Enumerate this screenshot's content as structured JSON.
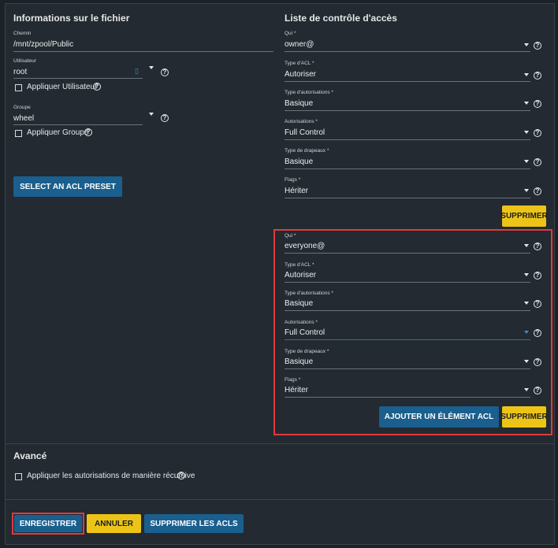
{
  "file_info": {
    "title": "Informations sur le fichier",
    "path": {
      "label": "Chemin",
      "value": "/mnt/zpool/Public"
    },
    "user": {
      "label": "Utilisateur",
      "value": "root",
      "apply_label": "Appliquer Utilisateur"
    },
    "group": {
      "label": "Groupe",
      "value": "wheel",
      "apply_label": "Appliquer Groupe"
    },
    "preset_button": "SELECT AN ACL PRESET"
  },
  "acl": {
    "title": "Liste de contrôle d'accès",
    "entries": [
      {
        "who": {
          "label": "Qui *",
          "value": "owner@"
        },
        "acl_type": {
          "label": "Type d'ACL *",
          "value": "Autoriser"
        },
        "perm_type": {
          "label": "Type d'autorisations *",
          "value": "Basique"
        },
        "perms": {
          "label": "Autorisations *",
          "value": "Full Control"
        },
        "flag_type": {
          "label": "Type de drapeaux *",
          "value": "Basique"
        },
        "flags": {
          "label": "Flags *",
          "value": "Hériter"
        },
        "delete_button": "SUPPRIMER"
      },
      {
        "who": {
          "label": "Qui *",
          "value": "everyone@"
        },
        "acl_type": {
          "label": "Type d'ACL *",
          "value": "Autoriser"
        },
        "perm_type": {
          "label": "Type d'autorisations *",
          "value": "Basique"
        },
        "perms": {
          "label": "Autorisations *",
          "value": "Full Control"
        },
        "flag_type": {
          "label": "Type de drapeaux *",
          "value": "Basique"
        },
        "flags": {
          "label": "Flags *",
          "value": "Hériter"
        },
        "add_button": "AJOUTER UN ÉLÉMENT ACL",
        "delete_button": "SUPPRIMER"
      }
    ]
  },
  "advanced": {
    "title": "Avancé",
    "recursive_label": "Appliquer les autorisations de manière récursive"
  },
  "footer": {
    "save": "ENREGISTRER",
    "cancel": "ANNULER",
    "strip": "SUPPRIMER LES ACLS"
  },
  "colors": {
    "blue_button": "#1a5f8e",
    "yellow_button": "#ecc418",
    "highlight": "#e03a3e",
    "background": "#232a31"
  },
  "icons": {
    "help": "question-circle-icon",
    "dropdown": "caret-down-icon",
    "checkbox": "checkbox-empty-icon"
  }
}
